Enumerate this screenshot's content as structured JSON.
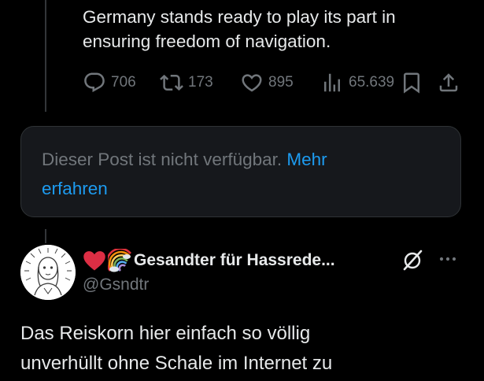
{
  "top_post": {
    "text_line1": "Germany stands ready to play its part in",
    "text_line2": "ensuring freedom of navigation.",
    "actions": {
      "replies": "706",
      "reposts": "173",
      "likes": "895",
      "views": "65.639"
    },
    "icons": {
      "reply": "reply-icon",
      "repost": "repost-icon",
      "like": "heart-icon",
      "views": "views-icon",
      "bookmark": "bookmark-icon",
      "share": "share-icon"
    }
  },
  "unavailable": {
    "text": "Dieser Post ist nicht verfügbar.",
    "link_part1": "Mehr",
    "link_part2": "erfahren"
  },
  "reply_post": {
    "display_name": "Gesandter für Hassrede...",
    "name_emojis": [
      "red-heart-emoji",
      "rainbow-emoji"
    ],
    "handle": "@Gsndtr",
    "text_line1": "Das Reiskorn hier einfach so völlig",
    "text_line2": "unverhüllt ohne Schale im Internet zu",
    "icons": {
      "grok": "grok-icon",
      "more": "more-icon"
    }
  },
  "colors": {
    "background": "#000000",
    "text_primary": "#e7e9ea",
    "text_secondary": "#71767b",
    "link": "#1d9bf0",
    "box_background": "#16181c",
    "border": "#2f3336"
  }
}
